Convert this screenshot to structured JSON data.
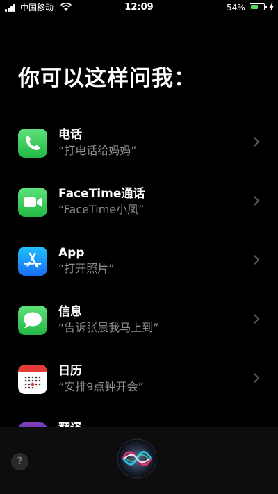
{
  "status_bar": {
    "carrier": "中国移动",
    "time": "12:09",
    "battery_percent": "54%",
    "battery_level": 0.54,
    "battery_color": "#4cd964",
    "icons": [
      "signal-icon",
      "wifi-icon",
      "battery-icon",
      "charging-bolt-icon"
    ]
  },
  "heading": "你可以这样问我：",
  "suggestions": [
    {
      "title": "电话",
      "example": "“打电话给妈妈”",
      "icon": "phone-icon",
      "icon_color": "#34c759"
    },
    {
      "title": "FaceTime通话",
      "example": "“FaceTime小凤”",
      "icon": "facetime-icon",
      "icon_color": "#34c759"
    },
    {
      "title": "App",
      "example": "“打开照片”",
      "icon": "app-store-icon",
      "icon_color": "#1a8cff"
    },
    {
      "title": "信息",
      "example": "“告诉张晨我马上到”",
      "icon": "messages-icon",
      "icon_color": "#34c759"
    },
    {
      "title": "日历",
      "example": "“安排9点钟开会”",
      "icon": "calendar-icon",
      "icon_color": "#ffffff"
    },
    {
      "title": "翻译",
      "icon": "translate-icon",
      "icon_color": "#6b2fa6"
    }
  ],
  "bottom_bar": {
    "help_label": "?",
    "icons": [
      "help-icon",
      "siri-icon"
    ]
  }
}
